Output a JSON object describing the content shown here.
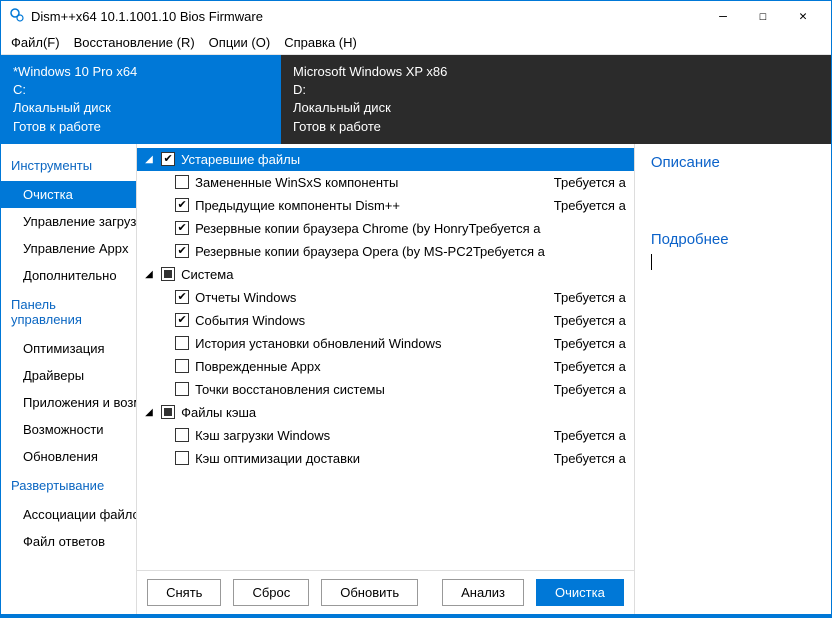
{
  "window": {
    "title": "Dism++x64 10.1.1001.10 Bios Firmware"
  },
  "menu": {
    "file": "Файл(F)",
    "recovery": "Восстановление (R)",
    "options": "Опции (O)",
    "help": "Справка (H)"
  },
  "os": {
    "active": {
      "name": "*Windows 10 Pro x64",
      "drive": "C:",
      "type": "Локальный диск",
      "state": "Готов к работе"
    },
    "inactive": {
      "name": "Microsoft Windows XP x86",
      "drive": "D:",
      "type": "Локальный диск",
      "state": "Готов к работе"
    }
  },
  "sidebar": {
    "sections": [
      {
        "header": "Инструменты",
        "items": [
          "Очистка",
          "Управление загрузкой",
          "Управление Appx",
          "Дополнительно"
        ],
        "selected": 0
      },
      {
        "header": "Панель управления",
        "items": [
          "Оптимизация",
          "Драйверы",
          "Приложения и возможнос",
          "Возможности",
          "Обновления"
        ]
      },
      {
        "header": "Развертывание",
        "items": [
          "Ассоциации файлов",
          "Файл ответов"
        ]
      }
    ]
  },
  "tree": {
    "groups": [
      {
        "label": "Устаревшие файлы",
        "state": "checked",
        "selected": true,
        "items": [
          {
            "label": "Замененные WinSxS компоненты",
            "checked": false,
            "status": "Требуется а"
          },
          {
            "label": "Предыдущие компоненты Dism++",
            "checked": true,
            "status": "Требуется а"
          },
          {
            "label": "Резервные копии браузера Chrome (by HonryТребуется а",
            "checked": true,
            "status": ""
          },
          {
            "label": "Резервные копии браузера Opera (by MS-PC2Требуется а",
            "checked": true,
            "status": ""
          }
        ]
      },
      {
        "label": "Система",
        "state": "partial",
        "items": [
          {
            "label": "Отчеты Windows",
            "checked": true,
            "status": "Требуется а"
          },
          {
            "label": "События Windows",
            "checked": true,
            "status": "Требуется а"
          },
          {
            "label": "История установки обновлений Windows",
            "checked": false,
            "status": "Требуется а"
          },
          {
            "label": "Поврежденные Appx",
            "checked": false,
            "status": "Требуется а"
          },
          {
            "label": "Точки восстановления системы",
            "checked": false,
            "status": "Требуется а"
          }
        ]
      },
      {
        "label": "Файлы кэша",
        "state": "partial",
        "items": [
          {
            "label": "Кэш загрузки Windows",
            "checked": false,
            "status": "Требуется а"
          },
          {
            "label": "Кэш оптимизации доставки",
            "checked": false,
            "status": "Требуется а"
          }
        ]
      }
    ]
  },
  "buttons": {
    "uncheck": "Снять",
    "reset": "Сброс",
    "refresh": "Обновить",
    "analyze": "Анализ",
    "clean": "Очистка"
  },
  "right": {
    "desc": "Описание",
    "details": "Подробнее"
  }
}
